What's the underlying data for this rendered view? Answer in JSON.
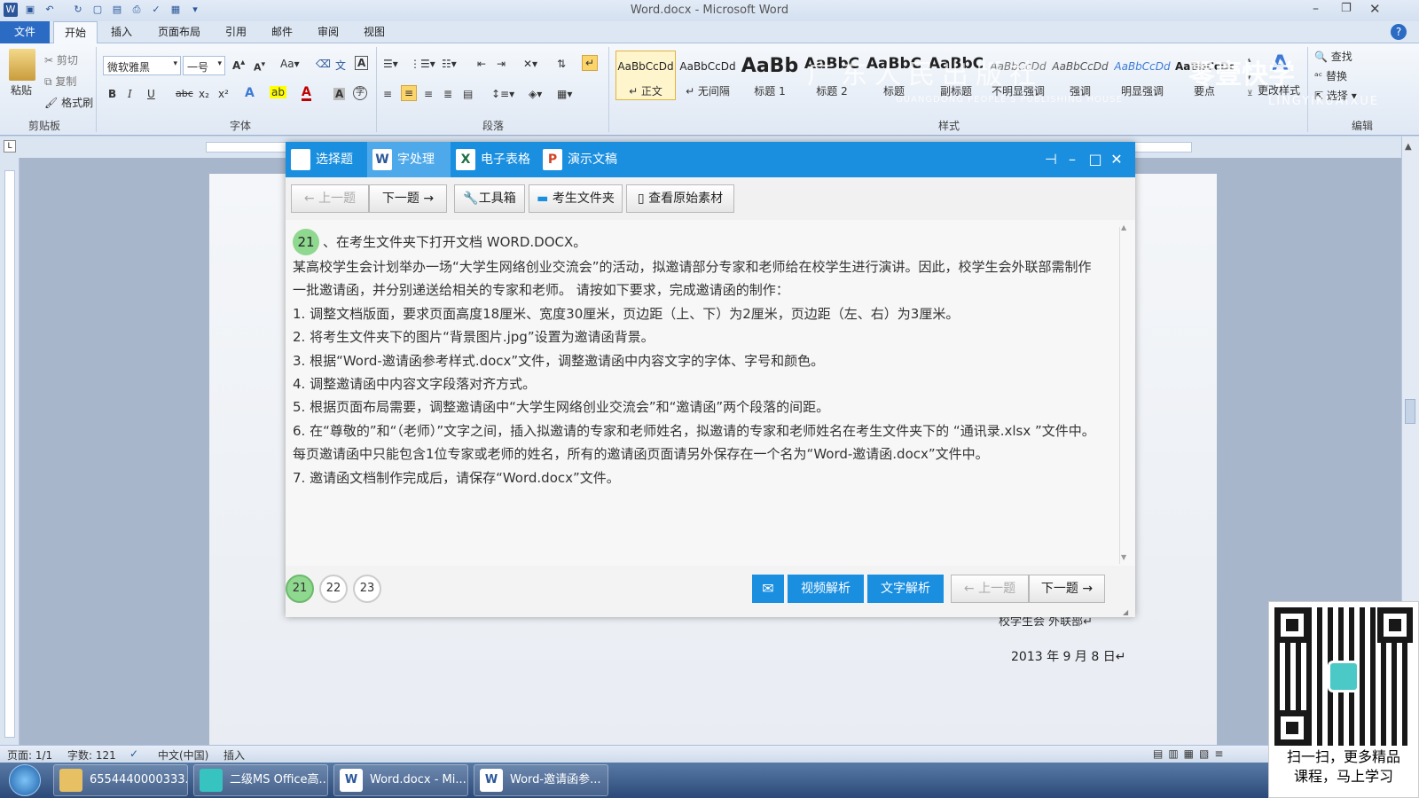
{
  "window": {
    "title": "Word.docx - Microsoft Word"
  },
  "ribbon_tabs": [
    "文件",
    "开始",
    "插入",
    "页面布局",
    "引用",
    "邮件",
    "审阅",
    "视图"
  ],
  "clipboard": {
    "paste": "粘贴",
    "cut": "剪切",
    "copy": "复制",
    "format_painter": "格式刷",
    "group": "剪贴板"
  },
  "font": {
    "name": "微软雅黑",
    "size": "一号",
    "group": "字体"
  },
  "paragraph": {
    "group": "段落"
  },
  "styles": {
    "group": "样式",
    "items": [
      {
        "sample": "AaBbCcDd",
        "name": "↵ 正文"
      },
      {
        "sample": "AaBbCcDd",
        "name": "↵ 无间隔"
      },
      {
        "sample": "AaBb",
        "name": "标题 1"
      },
      {
        "sample": "AaBbC",
        "name": "标题 2"
      },
      {
        "sample": "AaBbC",
        "name": "标题"
      },
      {
        "sample": "AaBbC",
        "name": "副标题"
      },
      {
        "sample": "AaBbCcDd",
        "name": "不明显强调"
      },
      {
        "sample": "AaBbCcDd",
        "name": "强调"
      },
      {
        "sample": "AaBbCcDd",
        "name": "明显强调"
      },
      {
        "sample": "AaBbCcDd",
        "name": "要点"
      }
    ],
    "change_styles": "更改样式"
  },
  "editing": {
    "find": "查找",
    "replace": "替换",
    "select": "选择",
    "group": "编辑"
  },
  "watermark": {
    "publisher": "广东人民出版社",
    "publisher_en": "GUANGDONG PEOPLE'S PUBLISHING HOUSE",
    "brand": "零壹快学",
    "brand_en": "LINGYIKUAIXUE"
  },
  "dialog": {
    "tabs": [
      {
        "label": "选择题",
        "active": false
      },
      {
        "label": "字处理",
        "active": true
      },
      {
        "label": "电子表格",
        "active": false
      },
      {
        "label": "演示文稿",
        "active": false
      }
    ],
    "toolbar": {
      "prev": "← 上一题",
      "next": "下一题 →",
      "toolbox": "工具箱",
      "student_folder": "考生文件夹",
      "view_original": "查看原始素材"
    },
    "question_number": "21",
    "question_lines": [
      "、在考生文件夹下打开文档 WORD.DOCX。",
      "某高校学生会计划举办一场“大学生网络创业交流会”的活动，拟邀请部分专家和老师给在校学生进行演讲。因此，校学生会外联部需制作一批邀请函，并分别递送给相关的专家和老师。 请按如下要求，完成邀请函的制作：",
      "1. 调整文档版面，要求页面高度18厘米、宽度30厘米，页边距（上、下）为2厘米，页边距（左、右）为3厘米。",
      "2. 将考生文件夹下的图片“背景图片.jpg”设置为邀请函背景。",
      "3. 根据“Word-邀请函参考样式.docx”文件，调整邀请函中内容文字的字体、字号和颜色。",
      "4. 调整邀请函中内容文字段落对齐方式。",
      "5. 根据页面布局需要，调整邀请函中“大学生网络创业交流会”和“邀请函”两个段落的间距。",
      "6. 在“尊敬的”和“（老师）”文字之间，插入拟邀请的专家和老师姓名，拟邀请的专家和老师姓名在考生文件夹下的 “通讯录.xlsx ”文件中。每页邀请函中只能包含1位专家或老师的姓名，所有的邀请函页面请另外保存在一个名为“Word-邀请函.docx”文件中。",
      "7. 邀请函文档制作完成后，请保存“Word.docx”文件。"
    ],
    "pages": [
      "21",
      "22",
      "23"
    ],
    "footer": {
      "video": "视频解析",
      "text": "文字解析",
      "prev": "← 上一题",
      "next": "下一题 →"
    }
  },
  "document": {
    "signature": "校学生会 外联部↵",
    "date": "2013 年 9 月 8 日↵"
  },
  "statusbar": {
    "page": "页面: 1/1",
    "words": "字数: 121",
    "language": "中文(中国)",
    "mode": "插入"
  },
  "taskbar": {
    "items": [
      "6554440000333...",
      "二级MS Office高...",
      "Word.docx - Mi...",
      "Word-邀请函参..."
    ]
  },
  "qr": {
    "caption_1": "扫一扫，更多精品",
    "caption_2": "课程，马上学习"
  }
}
